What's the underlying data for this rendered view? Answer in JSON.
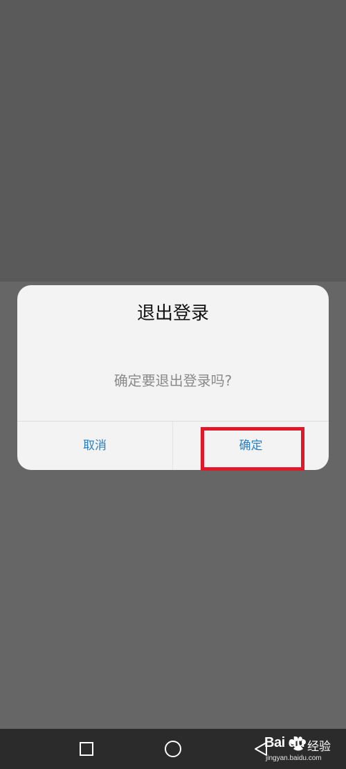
{
  "dialog": {
    "title": "退出登录",
    "message": "确定要退出登录吗?",
    "cancel_label": "取消",
    "confirm_label": "确定",
    "button_color": "#2a7ec0"
  },
  "annotation": {
    "highlight_color": "#e0182a",
    "highlights": "confirm-button"
  },
  "navbar": {
    "buttons": [
      {
        "icon": "square-recent-apps-icon"
      },
      {
        "icon": "circle-home-icon"
      },
      {
        "icon": "triangle-back-icon"
      }
    ]
  },
  "watermark": {
    "logo": "Bai du",
    "brand_cn": "经验",
    "url": "jingyan.baidu.com"
  }
}
